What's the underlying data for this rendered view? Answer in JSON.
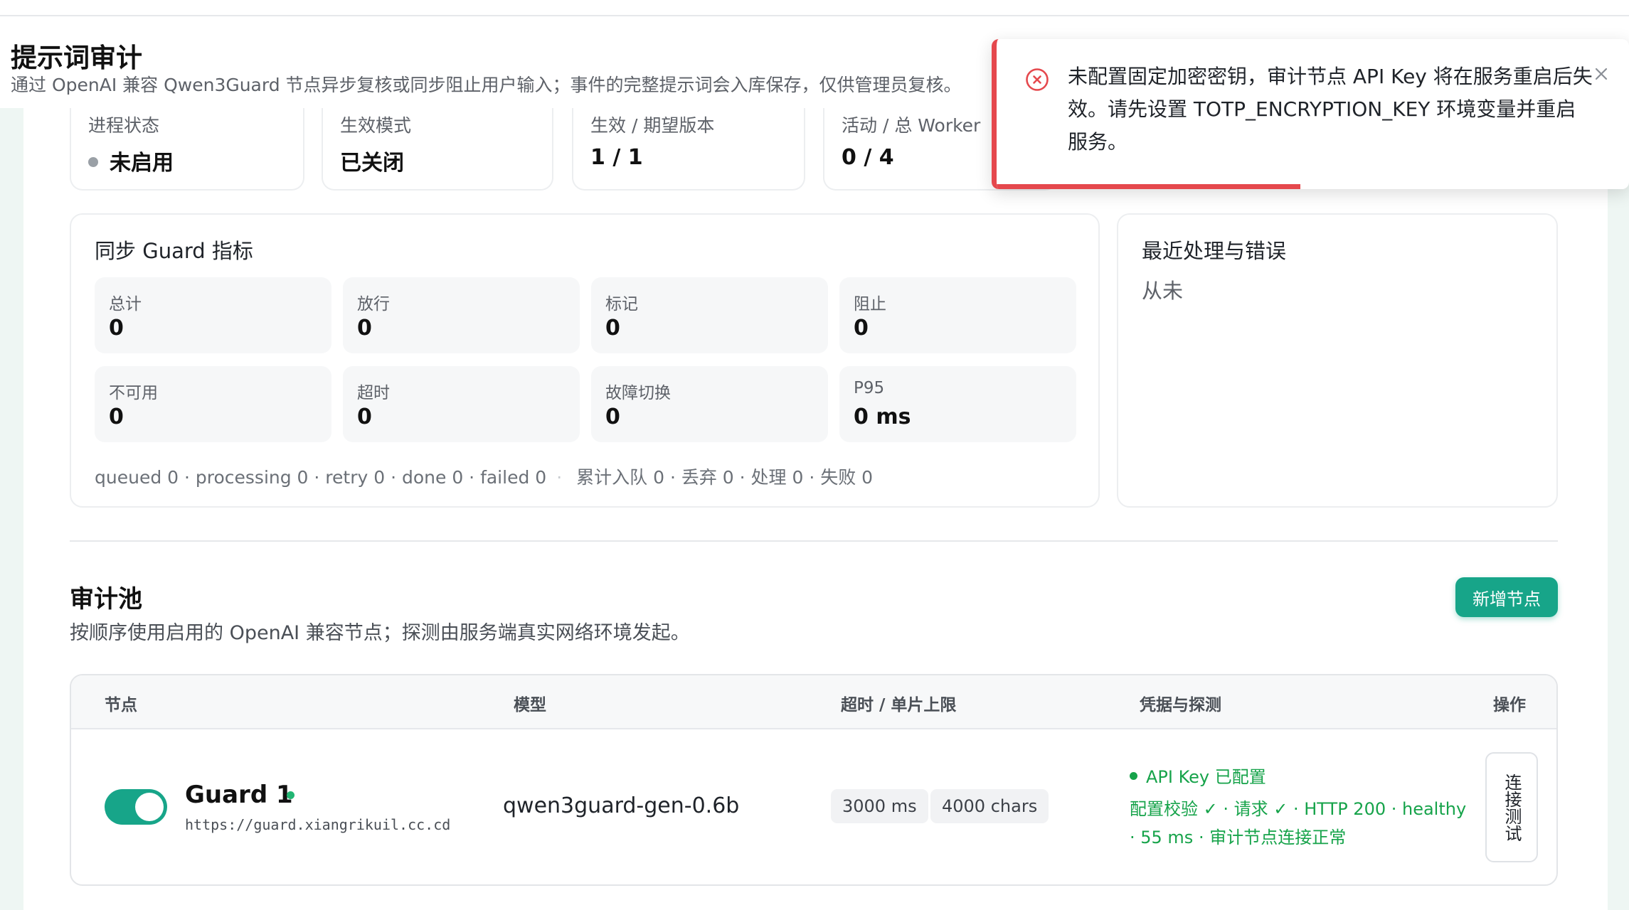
{
  "page": {
    "title": "提示词审计",
    "subtitle": "通过 OpenAI 兼容 Qwen3Guard 节点异步复核或同步阻止用户输入；事件的完整提示词会入库保存，仅供管理员复核。"
  },
  "status_cards": [
    {
      "label": "进程状态",
      "value": "未启用",
      "dot_color": "#9aa0a6"
    },
    {
      "label": "生效模式",
      "value": "已关闭"
    },
    {
      "label": "生效 / 期望版本",
      "value": "1 / 1"
    },
    {
      "label": "活动 / 总 Worker",
      "value": "0 / 4"
    }
  ],
  "sync_guard": {
    "title": "同步 Guard 指标",
    "metrics": [
      {
        "label": "总计",
        "value": "0"
      },
      {
        "label": "放行",
        "value": "0"
      },
      {
        "label": "标记",
        "value": "0"
      },
      {
        "label": "阻止",
        "value": "0"
      },
      {
        "label": "不可用",
        "value": "0"
      },
      {
        "label": "超时",
        "value": "0"
      },
      {
        "label": "故障切换",
        "value": "0"
      },
      {
        "label": "P95",
        "value": "0 ms"
      }
    ],
    "queue_stats": "queued 0 · processing 0 · retry 0 · done 0 · failed 0",
    "queue_separator": "·",
    "totals": "累计入队 0 · 丢弃 0 · 处理 0 · 失败 0"
  },
  "recent": {
    "title": "最近处理与错误",
    "empty_text": "从未"
  },
  "pool": {
    "title": "审计池",
    "description": "按顺序使用启用的 OpenAI 兼容节点；探测由服务端真实网络环境发起。",
    "add_button": "新增节点",
    "columns": [
      "节点",
      "模型",
      "超时 / 单片上限",
      "凭据与探测",
      "操作"
    ],
    "nodes": [
      {
        "enabled": true,
        "name": "Guard 1",
        "url": "https://guard.xiangrikuil.cc.cd",
        "model": "qwen3guard-gen-0.6b",
        "timeout": "3000 ms",
        "chunk_limit": "4000 chars",
        "credential": "API Key 已配置",
        "probe": "配置校验 ✓ · 请求 ✓ · HTTP 200 · healthy · 55 ms · 审计节点连接正常",
        "test_button": "连接测试"
      }
    ]
  },
  "toast": {
    "type": "error",
    "message": "未配置固定加密密钥，审计节点 API Key 将在服务重启后失效。请先设置 TOTP_ENCRYPTION_KEY 环境变量并重启服务。",
    "icon": "error-circle-icon",
    "close_icon": "close-icon",
    "progress": 0.48,
    "color": "#e5484d"
  },
  "colors": {
    "accent": "#17a589",
    "success": "#16a34a",
    "error": "#e5484d"
  }
}
